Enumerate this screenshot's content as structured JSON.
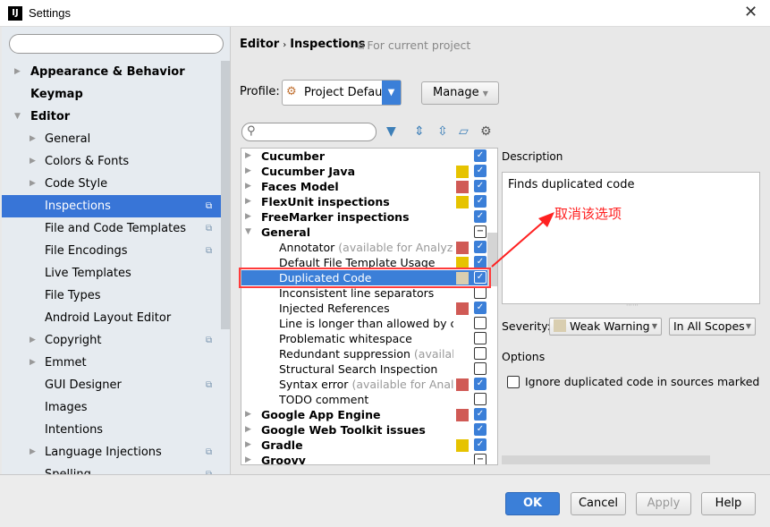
{
  "window": {
    "title": "Settings",
    "app_icon": "IJ"
  },
  "sidebar": {
    "items": [
      {
        "label": "Appearance & Behavior",
        "bold": true,
        "arrow": "right",
        "level": 0
      },
      {
        "label": "Keymap",
        "bold": true,
        "level": 0
      },
      {
        "label": "Editor",
        "bold": true,
        "arrow": "down",
        "level": 0
      },
      {
        "label": "General",
        "arrow": "right",
        "level": 1
      },
      {
        "label": "Colors & Fonts",
        "arrow": "right",
        "level": 1
      },
      {
        "label": "Code Style",
        "arrow": "right",
        "level": 1
      },
      {
        "label": "Inspections",
        "level": 1,
        "selected": true,
        "project_icon": true
      },
      {
        "label": "File and Code Templates",
        "level": 1,
        "project_icon": true
      },
      {
        "label": "File Encodings",
        "level": 1,
        "project_icon": true
      },
      {
        "label": "Live Templates",
        "level": 1
      },
      {
        "label": "File Types",
        "level": 1
      },
      {
        "label": "Android Layout Editor",
        "level": 1
      },
      {
        "label": "Copyright",
        "arrow": "right",
        "level": 1,
        "project_icon": true
      },
      {
        "label": "Emmet",
        "arrow": "right",
        "level": 1
      },
      {
        "label": "GUI Designer",
        "level": 1,
        "project_icon": true
      },
      {
        "label": "Images",
        "level": 1
      },
      {
        "label": "Intentions",
        "level": 1
      },
      {
        "label": "Language Injections",
        "arrow": "right",
        "level": 1,
        "project_icon": true
      },
      {
        "label": "Spelling",
        "level": 1,
        "project_icon": true
      }
    ]
  },
  "header": {
    "crumb1": "Editor",
    "crumb_sep": "›",
    "crumb2": "Inspections",
    "scope": "For current project"
  },
  "profile": {
    "label": "Profile:",
    "value": "Project Default",
    "manage": "Manage"
  },
  "colors": {
    "error": "#d05a55",
    "warning": "#e6c300",
    "weak_warning": "#d9ceb0",
    "accent": "#3b7fd8"
  },
  "tree": {
    "rows": [
      {
        "label": "Cucumber",
        "bold": true,
        "arrow": "right",
        "check": "on"
      },
      {
        "label": "Cucumber Java",
        "bold": true,
        "arrow": "right",
        "sev": "warning",
        "check": "on"
      },
      {
        "label": "Faces Model",
        "bold": true,
        "arrow": "right",
        "sev": "error",
        "check": "on"
      },
      {
        "label": "FlexUnit inspections",
        "bold": true,
        "arrow": "right",
        "sev": "warning",
        "check": "on"
      },
      {
        "label": "FreeMarker inspections",
        "bold": true,
        "arrow": "right",
        "check": "on"
      },
      {
        "label": "General",
        "bold": true,
        "arrow": "down",
        "check": "mixed"
      },
      {
        "label": "Annotator",
        "muted": "(available for Analyze|I",
        "sev": "error",
        "check": "on",
        "child": true
      },
      {
        "label": "Default File Template Usage",
        "sev": "warning",
        "check": "on",
        "child": true
      },
      {
        "label": "Duplicated Code",
        "sev": "weak_warning",
        "check": "on",
        "child": true,
        "selected": true
      },
      {
        "label": "Inconsistent line separators",
        "check": "off",
        "child": true
      },
      {
        "label": "Injected References",
        "sev": "error",
        "check": "on",
        "child": true
      },
      {
        "label": "Line is longer than allowed by co",
        "check": "off",
        "child": true
      },
      {
        "label": "Problematic whitespace",
        "check": "off",
        "child": true
      },
      {
        "label": "Redundant suppression",
        "muted": "(available",
        "check": "off",
        "child": true
      },
      {
        "label": "Structural Search Inspection",
        "check": "off",
        "child": true
      },
      {
        "label": "Syntax error",
        "muted": "(available for Analyz",
        "sev": "error",
        "check": "on",
        "child": true
      },
      {
        "label": "TODO comment",
        "check": "off",
        "child": true
      },
      {
        "label": "Google App Engine",
        "bold": true,
        "arrow": "right",
        "sev": "error",
        "check": "on"
      },
      {
        "label": "Google Web Toolkit issues",
        "bold": true,
        "arrow": "right",
        "check": "on"
      },
      {
        "label": "Gradle",
        "bold": true,
        "arrow": "right",
        "sev": "warning",
        "check": "on"
      },
      {
        "label": "Groovy",
        "bold": true,
        "arrow": "right",
        "check": "mixed"
      }
    ]
  },
  "description": {
    "label": "Description",
    "text": "Finds duplicated code"
  },
  "severity": {
    "label": "Severity:",
    "value": "Weak Warning",
    "scope": "In All Scopes"
  },
  "options": {
    "label": "Options",
    "checkbox": "Ignore duplicated code in sources marked as",
    "checked": false
  },
  "annotation": {
    "text": "取消该选项"
  },
  "buttons": {
    "ok": "OK",
    "cancel": "Cancel",
    "apply": "Apply",
    "help": "Help"
  }
}
